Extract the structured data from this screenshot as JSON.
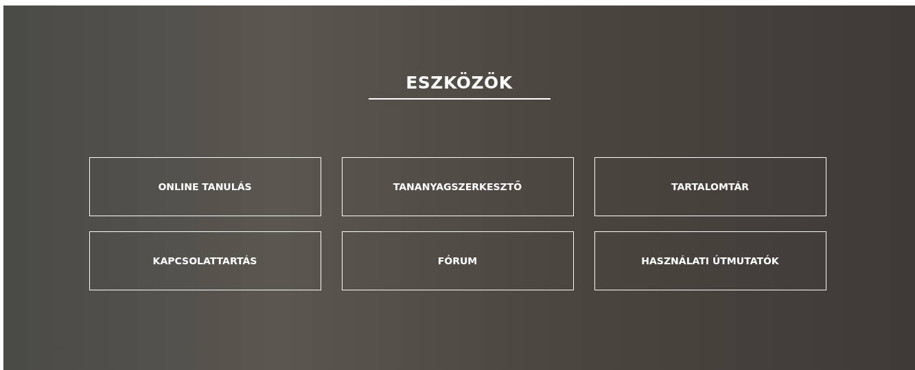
{
  "section": {
    "title": "ESZKÖZÖK"
  },
  "buttons": [
    {
      "label": "ONLINE TANULÁS"
    },
    {
      "label": "TANANYAGSZERKESZTŐ"
    },
    {
      "label": "TARTALOMTÁR"
    },
    {
      "label": "KAPCSOLATTARTÁS"
    },
    {
      "label": "FÓRUM"
    },
    {
      "label": "HASZNÁLATI ÚTMUTATÓK"
    }
  ]
}
